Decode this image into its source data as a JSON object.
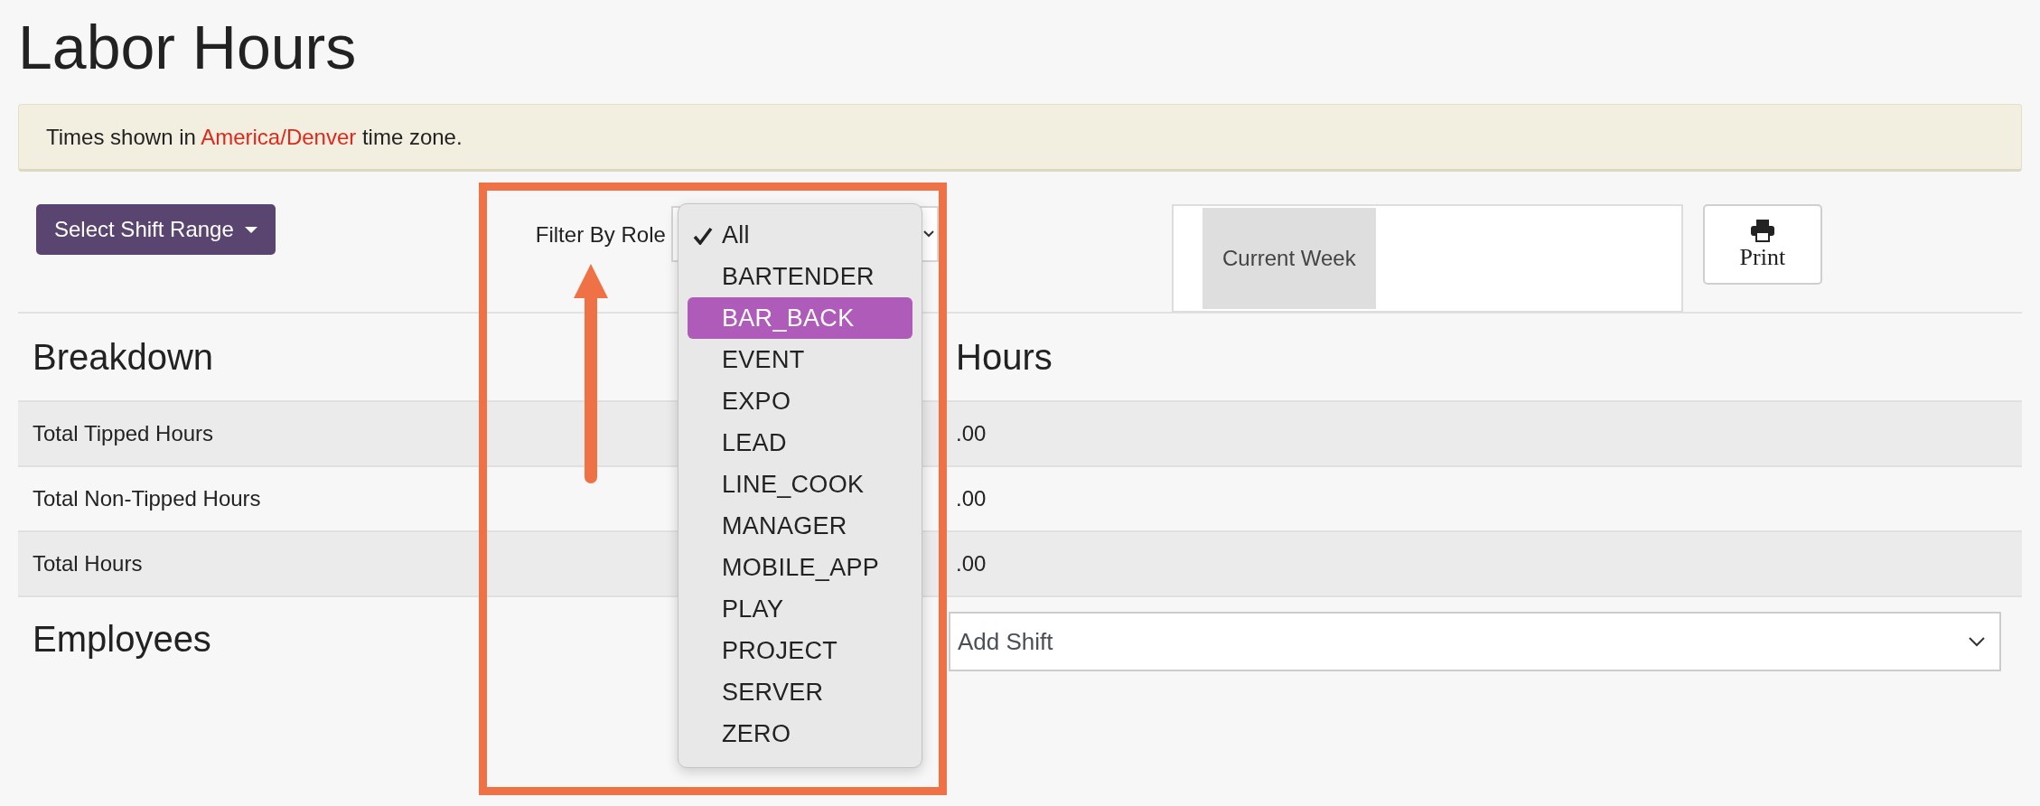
{
  "page_title": "Labor Hours",
  "notice": {
    "before": "Times shown in ",
    "link": "America/Denver",
    "after": " time zone."
  },
  "shift_range_button": {
    "label": "Select Shift Range"
  },
  "role_filter": {
    "label": "Filter By Role",
    "options": [
      {
        "label": "All",
        "checked": true,
        "selected": false
      },
      {
        "label": "BARTENDER",
        "checked": false,
        "selected": false
      },
      {
        "label": "BAR_BACK",
        "checked": false,
        "selected": true
      },
      {
        "label": "EVENT",
        "checked": false,
        "selected": false
      },
      {
        "label": "EXPO",
        "checked": false,
        "selected": false
      },
      {
        "label": "LEAD",
        "checked": false,
        "selected": false
      },
      {
        "label": "LINE_COOK",
        "checked": false,
        "selected": false
      },
      {
        "label": "MANAGER",
        "checked": false,
        "selected": false
      },
      {
        "label": "MOBILE_APP",
        "checked": false,
        "selected": false
      },
      {
        "label": "PLAY",
        "checked": false,
        "selected": false
      },
      {
        "label": "PROJECT",
        "checked": false,
        "selected": false
      },
      {
        "label": "SERVER",
        "checked": false,
        "selected": false
      },
      {
        "label": "ZERO",
        "checked": false,
        "selected": false
      }
    ]
  },
  "week_picker": {
    "label": "Current Week"
  },
  "print_button": {
    "label": "Print"
  },
  "breakdown": {
    "heading": "Breakdown",
    "column_2_heading": "Hours",
    "rows": [
      {
        "label": "Total Tipped Hours",
        "value": ".00"
      },
      {
        "label": "Total Non-Tipped Hours",
        "value": ".00"
      },
      {
        "label": "Total Hours",
        "value": ".00"
      }
    ]
  },
  "employees": {
    "heading": "Employees",
    "shift_select": {
      "value": "Add Shift"
    }
  }
}
